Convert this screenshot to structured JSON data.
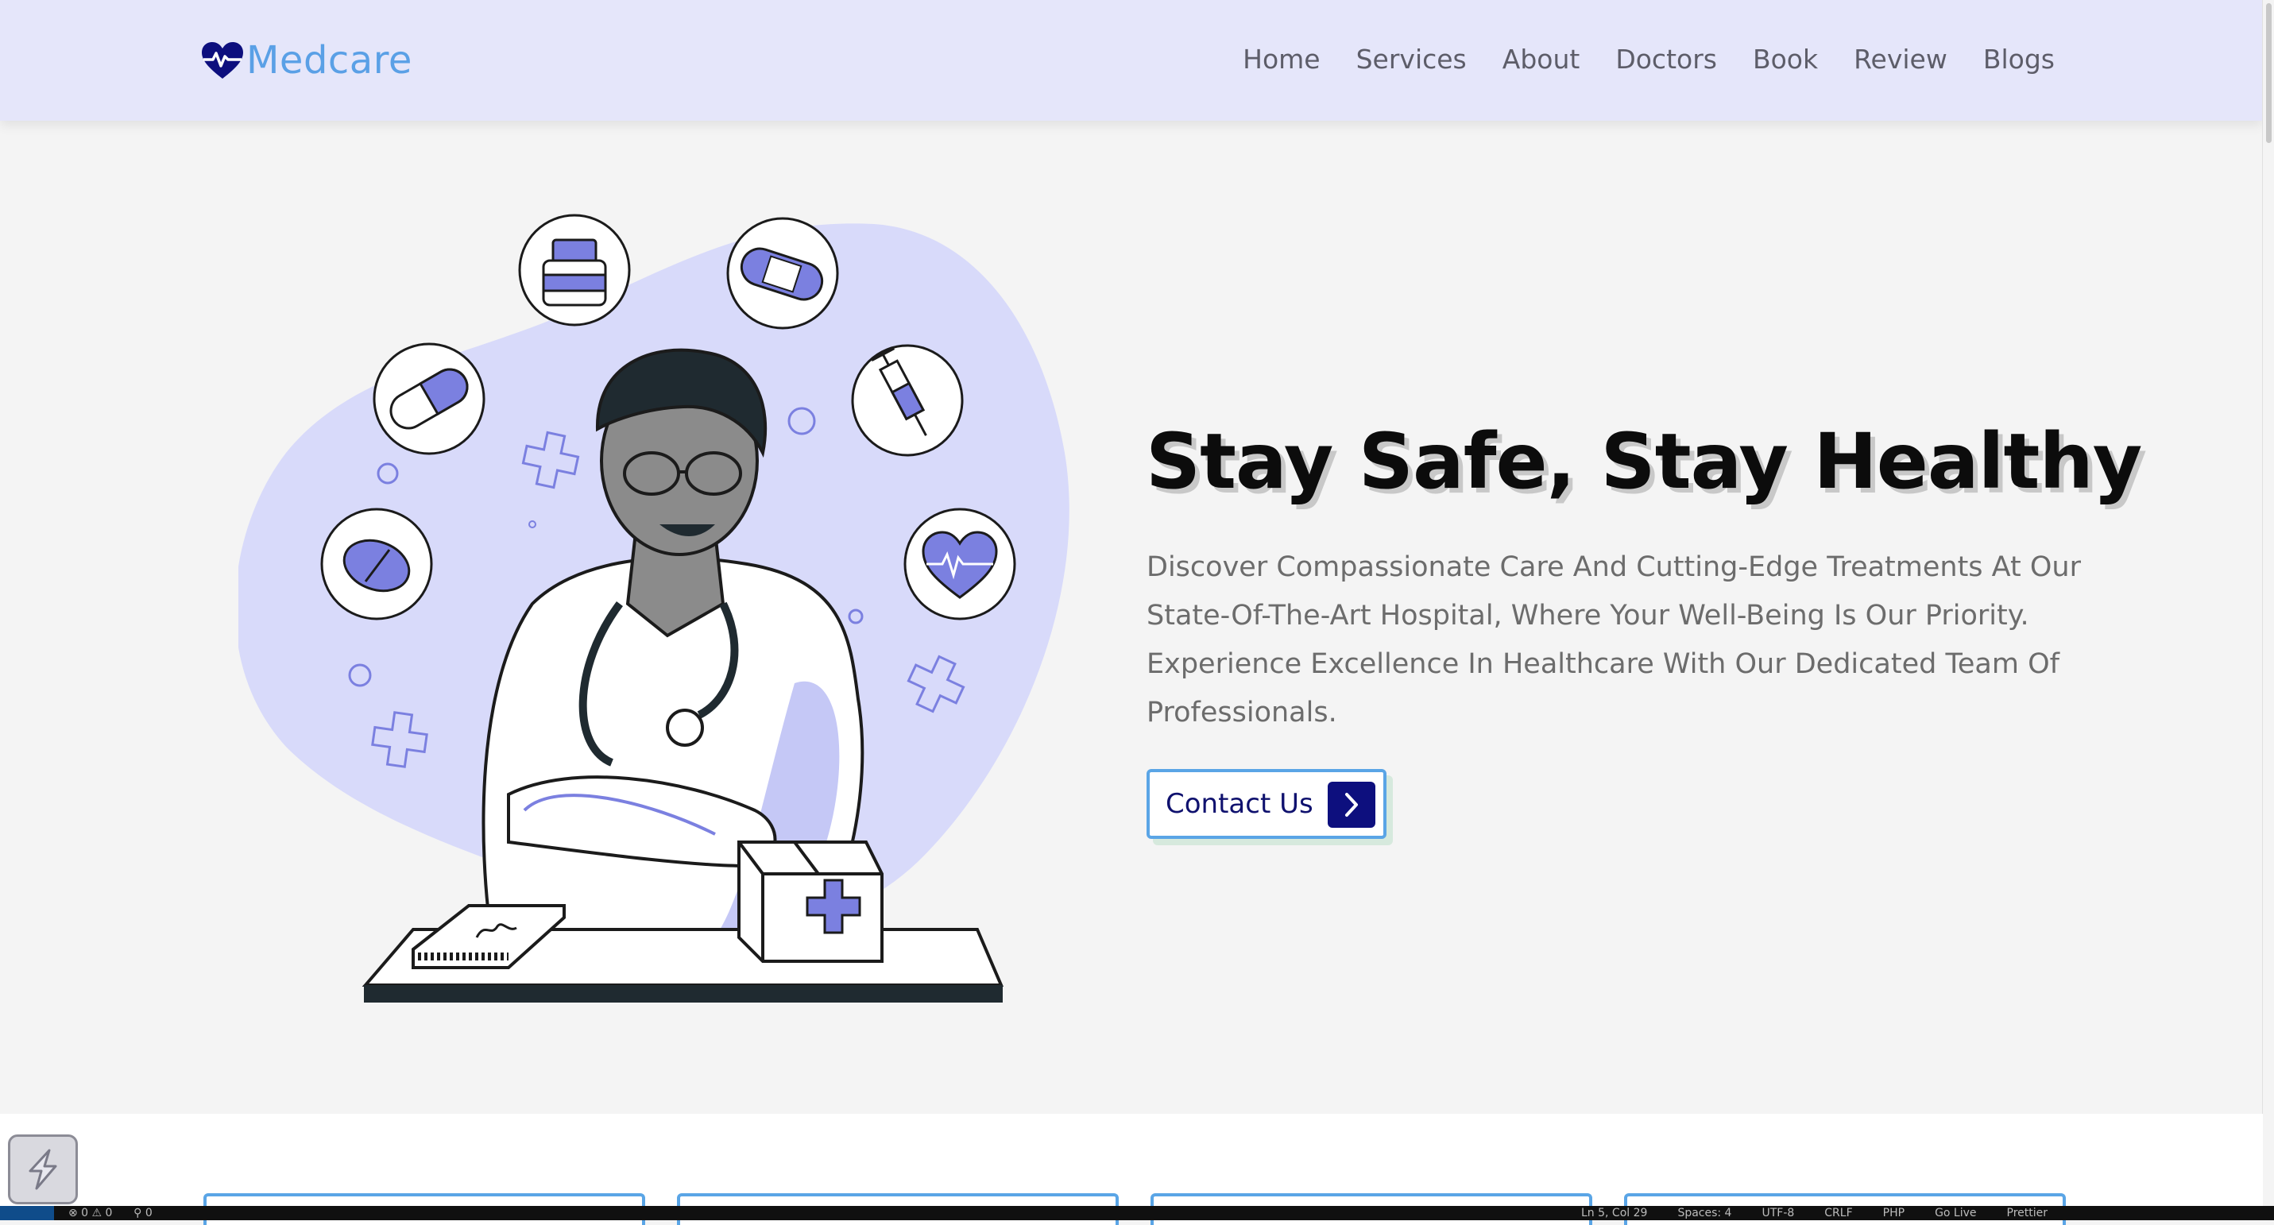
{
  "brand": {
    "name": "Medcare"
  },
  "nav": [
    "Home",
    "Services",
    "About",
    "Doctors",
    "Book",
    "Review",
    "Blogs"
  ],
  "hero": {
    "title": "Stay Safe, Stay Healthy",
    "description": "Discover Compassionate Care And Cutting-Edge Treatments At Our State-Of-The-Art Hospital, Where Your Well-Being Is Our Priority. Experience Excellence In Healthcare With Our Dedicated Team Of Professionals.",
    "cta": "Contact Us"
  },
  "statusbar": {
    "problems": "⊗ 0 ⚠ 0",
    "ports": "⚲ 0",
    "position": "Ln 5, Col 29",
    "spaces": "Spaces: 4",
    "encoding": "UTF-8",
    "eol": "CRLF",
    "language": "PHP",
    "golive": "Go Live",
    "prettier": "Prettier"
  },
  "colors": {
    "header_bg": "#e5e6fa",
    "brand_blue": "#5aa0e6",
    "accent_purple": "#7b80e0",
    "blob": "#d8dafa",
    "cta_dark": "#0d0f7e"
  },
  "icons": [
    "heartbeat-logo-icon",
    "chevron-right-icon"
  ]
}
